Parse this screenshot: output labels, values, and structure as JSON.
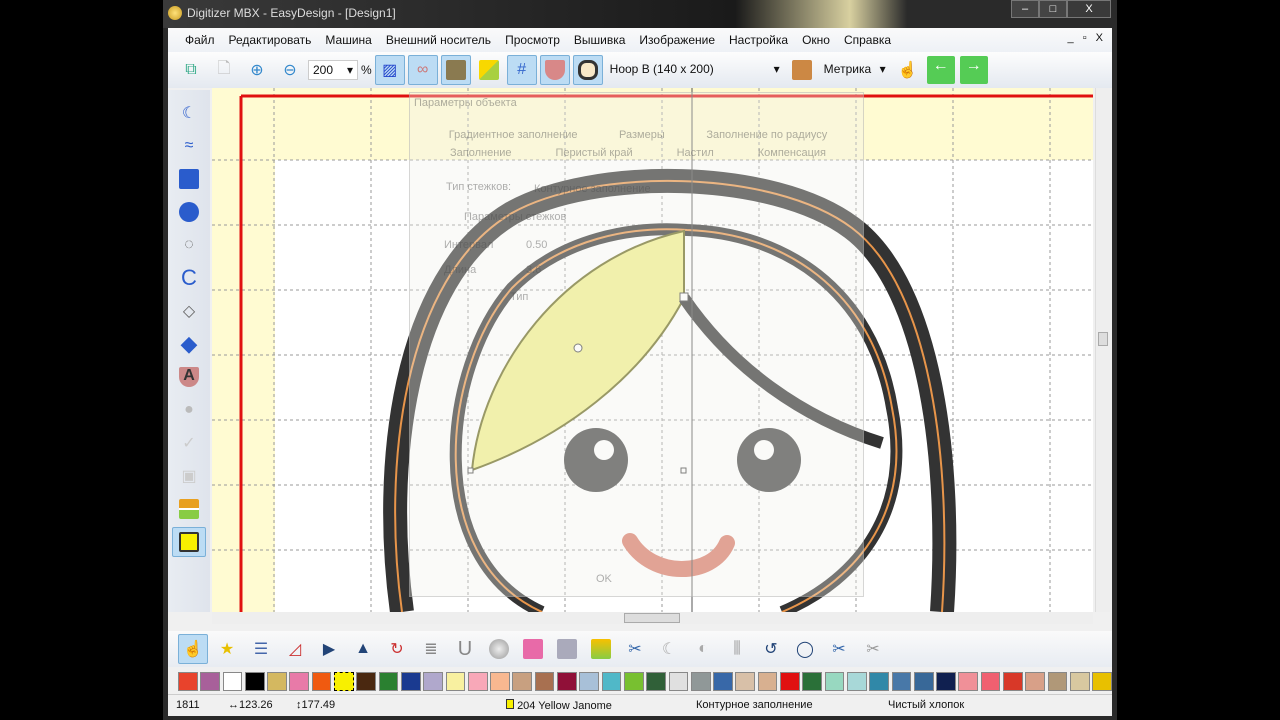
{
  "window": {
    "title": "Digitizer MBX - EasyDesign - [Design1]",
    "minimize": "–",
    "maximize": "□",
    "close": "X",
    "mdi_controls": "_ ▫ X"
  },
  "menu": [
    "Файл",
    "Редактировать",
    "Машина",
    "Внешний носитель",
    "Просмотр",
    "Вышивка",
    "Изображение",
    "Настройка",
    "Окно",
    "Справка"
  ],
  "toolbar": {
    "zoom_value": "200",
    "zoom_unit": "%",
    "hoop": "Hoop B (140 x 200)",
    "units": "Метрика"
  },
  "dialog": {
    "title": "Параметры объекта",
    "tabs_row1": [
      "Градиентное заполнение",
      "Размеры",
      "Заполнение по радиусу"
    ],
    "tabs_row2": [
      "Заполнение",
      "Перистый край",
      "Настил",
      "Компенсация"
    ],
    "stitch_type_label": "Тип стежков:",
    "stitch_type_value": "Контурное заполнение",
    "params_label": "Параметры стежков",
    "interval_label": "Интервал",
    "interval_value": "0.50",
    "length_label": "Длина",
    "length_value": "3.6",
    "type_label": "Тип",
    "ok": "OK"
  },
  "palette": [
    "#e8432c",
    "#a8609a",
    "#ffffff",
    "#000000",
    "#d4b860",
    "#e87aa8",
    "#f05a10",
    "#f8f000",
    "#4a2810",
    "#2a8030",
    "#1a3a90",
    "#b0a8cc",
    "#f8f0a0",
    "#f8a8b8",
    "#f8b890",
    "#c8a080",
    "#a87050",
    "#901038",
    "#a8c0d8",
    "#50b8c8",
    "#78c030",
    "#306038",
    "#e0e0e0",
    "#909898",
    "#3868a8",
    "#d8c0a8",
    "#d8b090",
    "#e01010",
    "#2a7038",
    "#98d8c0",
    "#a8d8d8",
    "#3088a8",
    "#4878a8",
    "#386898",
    "#102050",
    "#f09098",
    "#f06070",
    "#d83828",
    "#d8a088",
    "#b09878",
    "#d8c8a0",
    "#e8c000"
  ],
  "status": {
    "stitches": "1811",
    "width": "123.26",
    "height": "177.49",
    "thread": "204 Yellow Janome",
    "stitch_type": "Контурное заполнение",
    "fabric": "Чистый хлопок"
  }
}
